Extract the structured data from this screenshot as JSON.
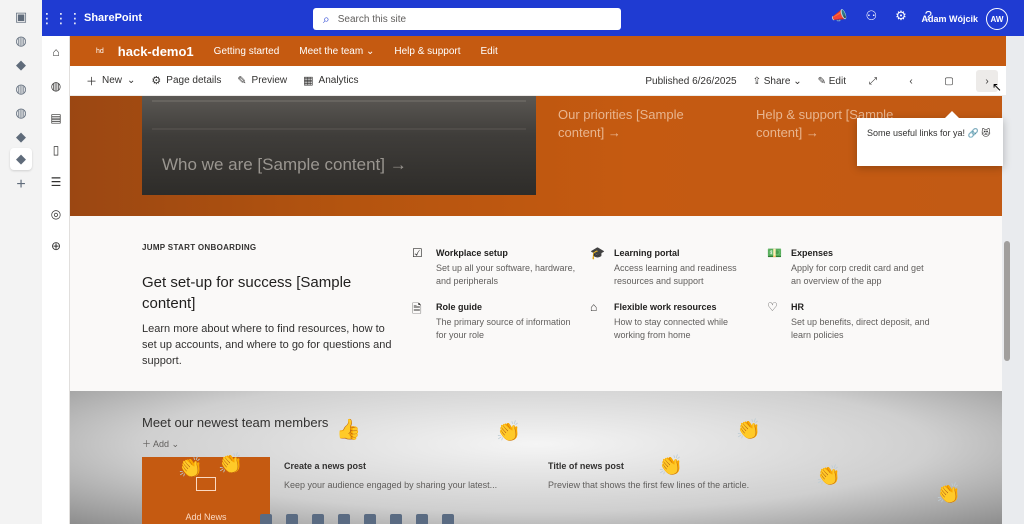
{
  "suitebar": {
    "brand": "SharePoint",
    "search_placeholder": "Search this site",
    "user_name": "Adam Wójcik",
    "user_initials": "AW"
  },
  "site": {
    "logo_text": "hd",
    "title": "hack-demo1",
    "nav": [
      "Getting started",
      "Meet the team",
      "Help & support",
      "Edit"
    ]
  },
  "commandbar": {
    "new_label": "New",
    "page_details_label": "Page details",
    "preview_label": "Preview",
    "analytics_label": "Analytics",
    "published_label": "Published 6/26/2025",
    "share_label": "Share",
    "edit_label": "Edit"
  },
  "hero": {
    "main_caption": "Who we are [Sample content] →",
    "tile_priorities": "Our priorities [Sample content] →",
    "tile_help": "Help & support [Sample content] →"
  },
  "tooltip": {
    "text": "Some useful links for ya! 🔗 😻"
  },
  "onboarding": {
    "eyebrow": "JUMP START ONBOARDING",
    "title": "Get set-up for success [Sample content]",
    "description": "Learn more about where to find resources, how to set up accounts, and where to go for questions and support.",
    "items": [
      {
        "title": "Workplace setup",
        "desc": "Set up all your software, hardware, and peripherals",
        "icon": "laptop-check-icon"
      },
      {
        "title": "Learning portal",
        "desc": "Access learning and readiness resources and support",
        "icon": "graduation-cap-icon"
      },
      {
        "title": "Expenses",
        "desc": "Apply for corp credit card and get an overview of the app",
        "icon": "money-icon"
      },
      {
        "title": "Role guide",
        "desc": "The primary source of information for your role",
        "icon": "document-person-icon"
      },
      {
        "title": "Flexible work resources",
        "desc": "How to stay connected while working from home",
        "icon": "home-icon"
      },
      {
        "title": "HR",
        "desc": "Set up benefits, direct deposit, and learn policies",
        "icon": "heart-pulse-icon"
      }
    ]
  },
  "news": {
    "title": "Meet our newest team members",
    "add_label": "Add",
    "thumb_label": "Add News",
    "items": [
      {
        "title": "Create a news post",
        "desc": "Keep your audience engaged by sharing your latest..."
      },
      {
        "title": "Title of news post",
        "desc": "Preview that shows the first few lines of the article."
      }
    ]
  },
  "colors": {
    "suitebar": "#1f3bd2",
    "site_header": "#c55a11"
  }
}
